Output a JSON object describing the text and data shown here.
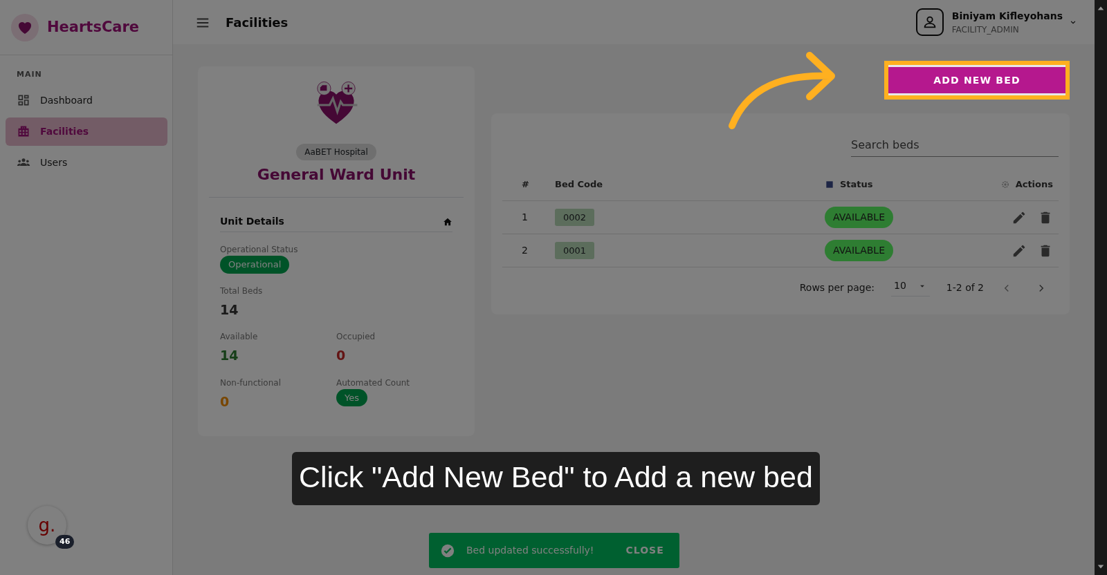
{
  "sidebar": {
    "brand": "HeartsCare",
    "section": "MAIN",
    "items": [
      {
        "label": "Dashboard",
        "selected": false
      },
      {
        "label": "Facilities",
        "selected": true
      },
      {
        "label": "Users",
        "selected": false
      }
    ]
  },
  "topbar": {
    "title": "Facilities",
    "user": {
      "name": "Biniyam Kifleyohans",
      "role": "FACILITY_ADMIN"
    }
  },
  "add_button": "ADD NEW BED",
  "unit": {
    "hospital": "AaBET Hospital",
    "title": "General Ward Unit",
    "details_title": "Unit Details",
    "status": {
      "label": "Operational Status",
      "value": "Operational"
    },
    "total": {
      "label": "Total Beds",
      "value": "14"
    },
    "grid": [
      {
        "label": "Available",
        "value": "14",
        "kind": "number"
      },
      {
        "label": "Occupied",
        "value": "0",
        "kind": "number"
      },
      {
        "label": "Non-functional",
        "value": "0",
        "kind": "number"
      },
      {
        "label": "Automated Count",
        "value": "Yes",
        "kind": "pill"
      }
    ]
  },
  "beds": {
    "search": {
      "placeholder": "Search beds"
    },
    "columns": [
      {
        "label": "#"
      },
      {
        "label": "Bed Code"
      },
      {
        "label": "Status"
      },
      {
        "label": "Actions"
      }
    ],
    "rows": [
      {
        "index": "1",
        "code": "0002",
        "status": "AVAILABLE"
      },
      {
        "index": "2",
        "code": "0001",
        "status": "AVAILABLE"
      }
    ],
    "pagination": {
      "rows_per_page_label": "Rows per page:",
      "rows_per_page": "10",
      "range": "1-2 of 2"
    }
  },
  "toast": {
    "message": "Bed updated successfully!",
    "action": "CLOSE"
  },
  "caption": "Click \"Add New Bed\" to Add a new bed",
  "widget": {
    "logo": "g.",
    "badge": "46"
  }
}
